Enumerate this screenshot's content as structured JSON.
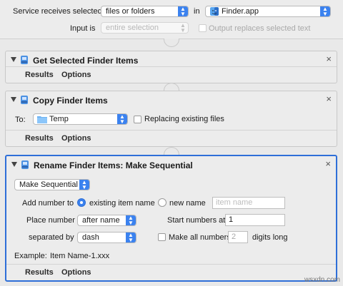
{
  "header": {
    "service_label": "Service receives selected",
    "service_value": "files or folders",
    "in_label": "in",
    "app_value": "Finder.app",
    "input_label": "Input is",
    "input_value": "entire selection",
    "output_label": "Output replaces selected text"
  },
  "action1": {
    "title": "Get Selected Finder Items",
    "results": "Results",
    "options": "Options",
    "close": "×"
  },
  "action2": {
    "title": "Copy Finder Items",
    "to_label": "To:",
    "folder": "Temp",
    "replace_label": "Replacing existing files",
    "results": "Results",
    "options": "Options",
    "close": "×"
  },
  "action3": {
    "title": "Rename Finder Items: Make Sequential",
    "mode": "Make Sequential",
    "add_number_label": "Add number to",
    "existing_label": "existing item name",
    "new_name_label": "new name",
    "item_name_placeholder": "item name",
    "place_label": "Place number",
    "place_value": "after name",
    "start_label": "Start numbers at",
    "start_value": "1",
    "separated_label": "separated by",
    "separated_value": "dash",
    "make_all_label": "Make all numbers",
    "digits_value": "2",
    "digits_label": "digits long",
    "example_label": "Example:",
    "example_value": "Item Name-1.xxx",
    "results": "Results",
    "options": "Options",
    "close": "×"
  },
  "watermark": "wsxdn.com",
  "colors": {
    "accent": "#3b82ef",
    "selection_border": "#2e6fd8"
  }
}
